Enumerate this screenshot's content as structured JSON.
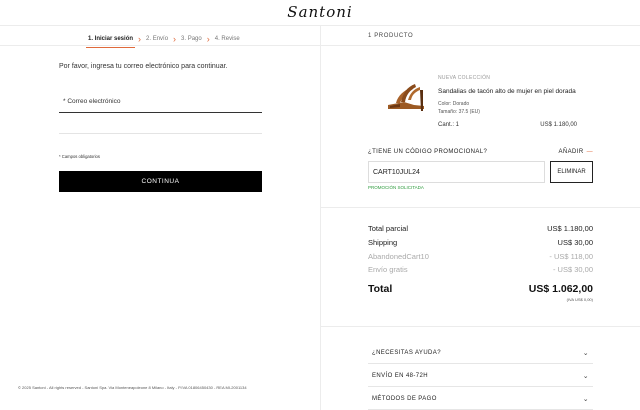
{
  "header": {
    "logo": "Santoni"
  },
  "steps": [
    {
      "label": "1. Iniciar sesión",
      "active": true
    },
    {
      "label": "2. Envío"
    },
    {
      "label": "3. Pago"
    },
    {
      "label": "4. Revise"
    }
  ],
  "login": {
    "intro": "Por favor, ingresa tu correo electrónico para continuar.",
    "email_label": "* Correo electrónico",
    "email_value": "",
    "required_note": "* Campos obligatorios",
    "continue_label": "CONTINUA"
  },
  "footer": {
    "text": "© 2025 Santoni - All rights reserved - Santoni Spa. Via Monteneapoleone 8 Milano - Italy - P.IVA 01806450430 - REA MI-2001134"
  },
  "order": {
    "title": "1 PRODUCTO",
    "product": {
      "tag": "NUEVA COLECCIÓN",
      "name": "Sandalias de tacón alto de mujer en piel dorada",
      "color": "Color: Dorado",
      "size": "Tamaño: 37.5 (EU)",
      "qty": "Cant.: 1",
      "price": "US$ 1.180,00",
      "image_icon": "sandal-icon"
    },
    "promo": {
      "question": "¿TIENE UN CÓDIGO PROMOCIONAL?",
      "add_label": "AÑADIR",
      "code": "CART10JUL24",
      "remove_label": "ELIMINAR",
      "status": "PROMOCIÓN SOLICITADA"
    },
    "summary": [
      {
        "label": "Total parcial",
        "value": "US$ 1.180,00",
        "style": "dark"
      },
      {
        "label": "Shipping",
        "value": "US$ 30,00",
        "style": "dark"
      },
      {
        "label": "AbandonedCart10",
        "value": "- US$ 118,00",
        "style": "muted"
      },
      {
        "label": "Envío gratis",
        "value": "- US$ 30,00",
        "style": "muted"
      }
    ],
    "total": {
      "label": "Total",
      "value": "US$ 1.062,00",
      "tax": "(IVA US$ 0,00)"
    },
    "accordions": [
      {
        "label": "¿NECESITAS AYUDA?"
      },
      {
        "label": "ENVÍO EN 48-72H"
      },
      {
        "label": "MÉTODOS DE PAGO"
      }
    ]
  },
  "colors": {
    "accent": "#e06a3c",
    "promo_ok": "#2e9b3e",
    "button": "#000000"
  }
}
